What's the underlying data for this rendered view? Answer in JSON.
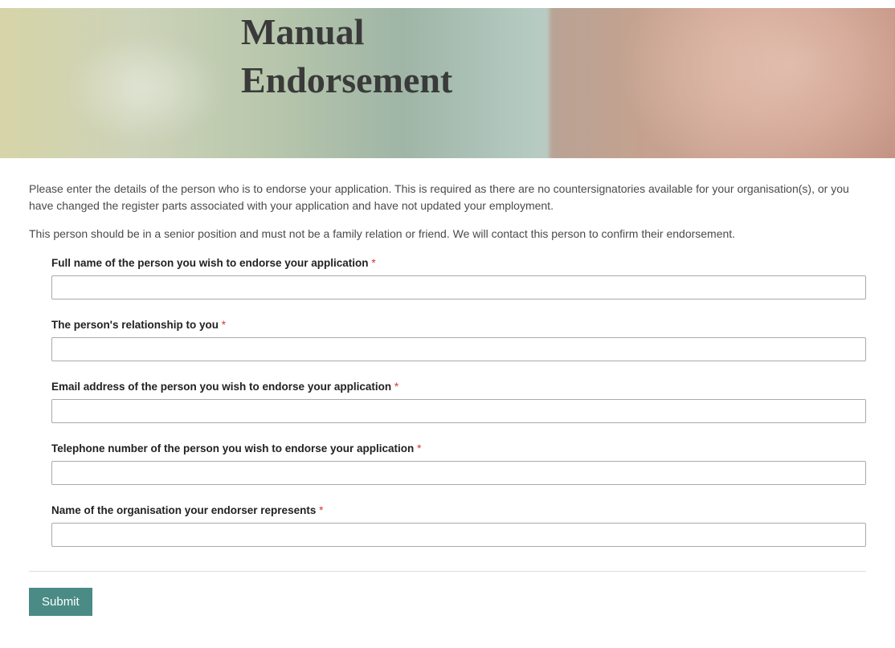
{
  "hero": {
    "title_line1": "Manual",
    "title_line2": "Endorsement"
  },
  "intro": {
    "paragraph1": "Please enter the details of the person who is to endorse your application. This is required as there are no countersignatories available for your organisation(s), or you have changed the register parts associated with your application and have not updated your employment.",
    "paragraph2": "This person should be in a senior position and must not be a family relation or friend. We will contact this person to confirm their endorsement."
  },
  "form": {
    "fields": [
      {
        "label": "Full name of the person you wish to endorse your application",
        "required": true,
        "value": ""
      },
      {
        "label": "The person's relationship to you",
        "required": true,
        "value": ""
      },
      {
        "label": "Email address of the person you wish to endorse your application",
        "required": true,
        "value": ""
      },
      {
        "label": "Telephone number of the person you wish to endorse your application",
        "required": true,
        "value": ""
      },
      {
        "label": "Name of the organisation your endorser represents",
        "required": true,
        "value": ""
      }
    ],
    "submit_label": "Submit",
    "required_marker": "*"
  }
}
